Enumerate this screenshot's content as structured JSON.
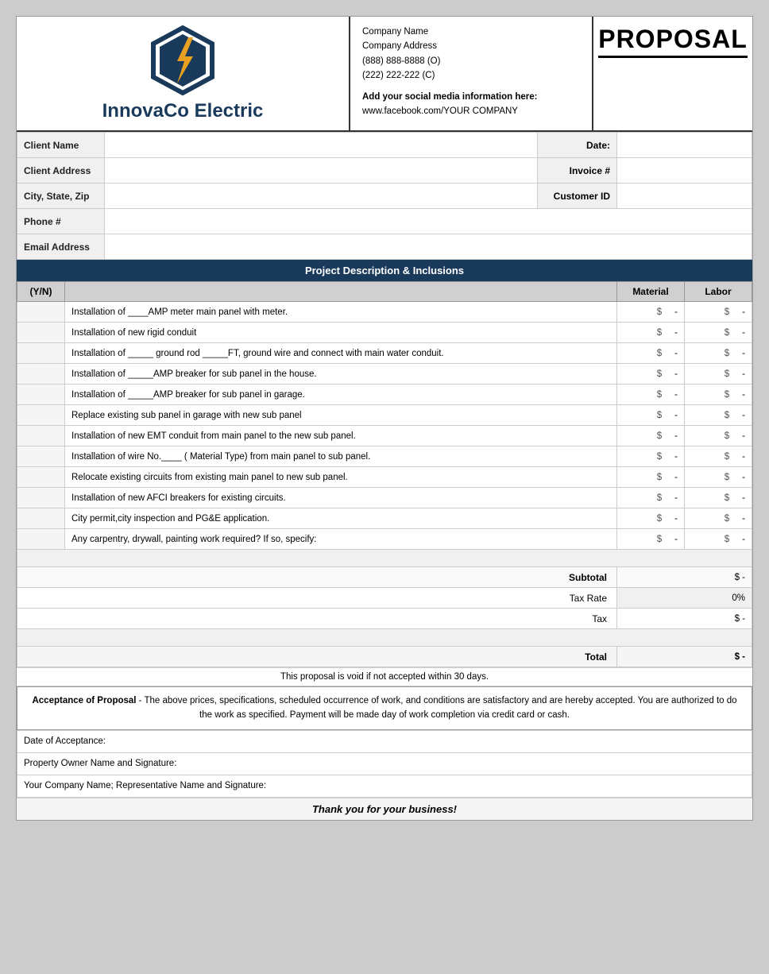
{
  "header": {
    "proposal_title": "PROPOSAL",
    "logo_text_innovaco": "InnovaCo",
    "logo_text_electric": " Electric",
    "company_name": "Company Name",
    "company_address": "Company Address",
    "company_phone_o": "(888) 888-8888 (O)",
    "company_phone_c": "(222) 222-222 (C)",
    "social_label": "Add your social media information here:",
    "social_link": "www.facebook.com/YOUR COMPANY"
  },
  "client_fields": {
    "client_name_label": "Client Name",
    "client_address_label": "Client Address",
    "city_state_zip_label": "City, State, Zip",
    "phone_label": "Phone #",
    "email_label": "Email Address",
    "date_label": "Date:",
    "invoice_label": "Invoice #",
    "customer_id_label": "Customer ID"
  },
  "project": {
    "section_title": "Project Description & Inclusions",
    "col_yn": "(Y/N)",
    "col_material": "Material",
    "col_labor": "Labor",
    "items": [
      {
        "desc": "Installation of ____AMP meter main panel with meter.",
        "material": "$    -",
        "labor": "$    -"
      },
      {
        "desc": "Installation of new rigid conduit",
        "material": "$    -",
        "labor": "$    -"
      },
      {
        "desc": "Installation of _____ ground rod _____FT, ground wire and connect with main water conduit.",
        "material": "$    -",
        "labor": "$    -"
      },
      {
        "desc": "Installation of _____AMP breaker for sub panel in the house.",
        "material": "$    -",
        "labor": "$    -"
      },
      {
        "desc": "Installation of _____AMP breaker for sub panel in garage.",
        "material": "$    -",
        "labor": "$    -"
      },
      {
        "desc": "Replace existing sub panel in garage with new sub panel",
        "material": "$    -",
        "labor": "$    -"
      },
      {
        "desc": "Installation of new EMT conduit from main panel to the new sub panel.",
        "material": "$    -",
        "labor": "$    -"
      },
      {
        "desc": "Installation of wire No.____ ( Material Type) from main panel to sub panel.",
        "material": "$    -",
        "labor": "$    -"
      },
      {
        "desc": "Relocate existing circuits from existing main panel to new sub panel.",
        "material": "$    -",
        "labor": "$    -"
      },
      {
        "desc": "Installation of new AFCI breakers for existing circuits.",
        "material": "$    -",
        "labor": "$    -"
      },
      {
        "desc": "City permit,city inspection and PG&E application.",
        "material": "$    -",
        "labor": "$    -"
      },
      {
        "desc": "Any carpentry, drywall, painting work required? If so, specify:",
        "material": "$    -",
        "labor": "$    -"
      }
    ],
    "subtotal_label": "Subtotal",
    "subtotal_value": "$                 -",
    "tax_rate_label": "Tax Rate",
    "tax_rate_value": "0%",
    "tax_label": "Tax",
    "tax_value": "$         -",
    "total_label": "Total",
    "total_value": "$                 -"
  },
  "footer": {
    "void_notice": "This proposal is void if not accepted within 30 days.",
    "acceptance_title": "Acceptance of Proposal",
    "acceptance_text": " - The above prices, specifications, scheduled occurrence of work, and conditions are satisfactory and are hereby accepted. You are authorized to do the work as specified. Payment will be made day of work completion via credit card or cash.",
    "date_of_acceptance": "Date of Acceptance:",
    "property_owner": "Property Owner Name and Signature:",
    "company_rep": "Your Company Name; Representative Name and Signature:",
    "thank_you": "Thank you for your business!"
  }
}
